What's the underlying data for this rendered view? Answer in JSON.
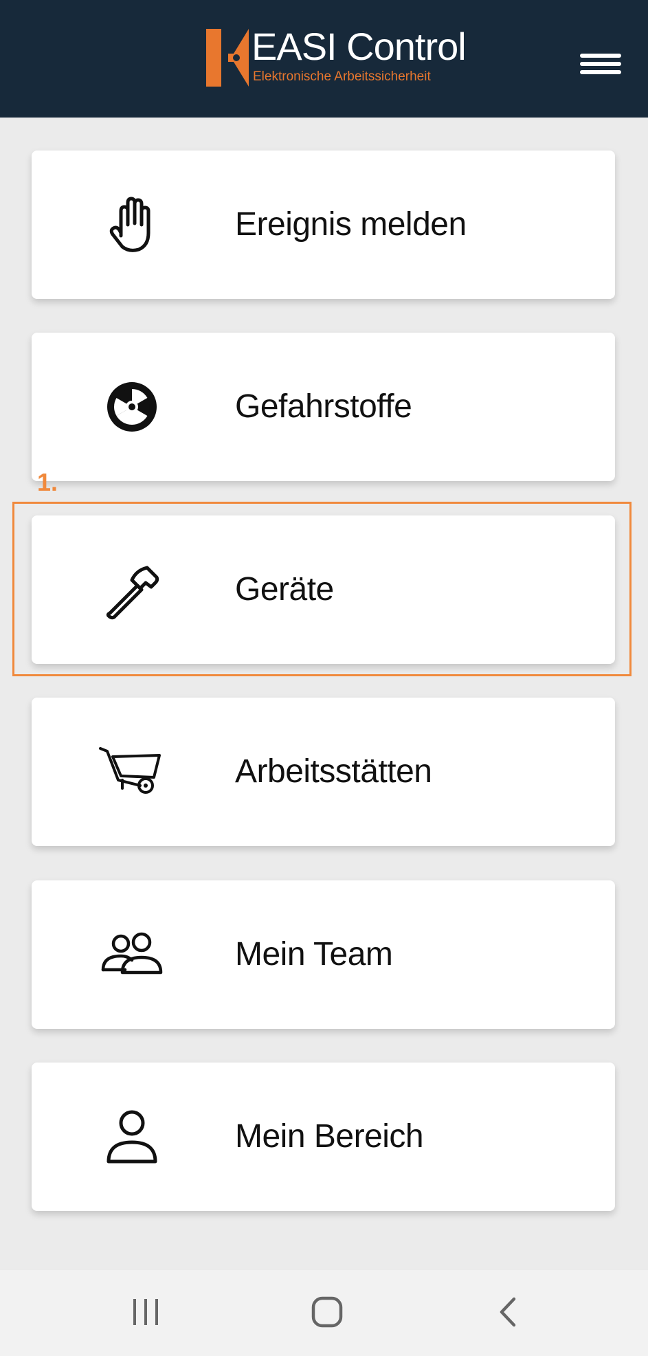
{
  "header": {
    "logo_title": "EASI Control",
    "logo_subtitle": "Elektronische Arbeitssicherheit",
    "menu_icon": "hamburger-menu-icon",
    "background_color": "#17293a",
    "accent_color": "#e8772e"
  },
  "menu": {
    "items": [
      {
        "label": "Ereignis melden",
        "icon": "hand-stop-icon"
      },
      {
        "label": "Gefahrstoffe",
        "icon": "radiation-icon"
      },
      {
        "label": "Geräte",
        "icon": "hammer-icon"
      },
      {
        "label": "Arbeitsstätten",
        "icon": "wheelbarrow-icon"
      },
      {
        "label": "Mein Team",
        "icon": "team-icon"
      },
      {
        "label": "Mein Bereich",
        "icon": "user-icon"
      }
    ]
  },
  "annotation": {
    "step_label": "1.",
    "highlight_color": "#f0893c"
  },
  "navbar": {
    "items": [
      {
        "icon": "recent-apps-icon"
      },
      {
        "icon": "home-icon"
      },
      {
        "icon": "back-icon"
      }
    ]
  }
}
